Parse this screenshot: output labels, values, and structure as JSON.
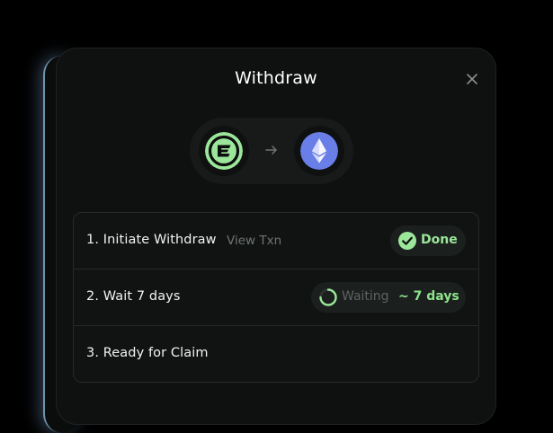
{
  "modal": {
    "title": "Withdraw"
  },
  "transfer": {
    "from_icon": "source-chain-e-logo-icon",
    "to_icon": "ethereum-logo-icon",
    "arrow_icon": "arrow-right-icon"
  },
  "steps": [
    {
      "label": "1. Initiate Withdraw",
      "link": "View Txn",
      "status": "Done"
    },
    {
      "label": "2. Wait 7 days",
      "status": "Waiting",
      "eta": "~ 7 days"
    },
    {
      "label": "3. Ready for Claim"
    }
  ],
  "colors": {
    "accent_green": "#9be69a",
    "ethereum_blue": "#6a7ee8",
    "background": "#0f1010"
  }
}
